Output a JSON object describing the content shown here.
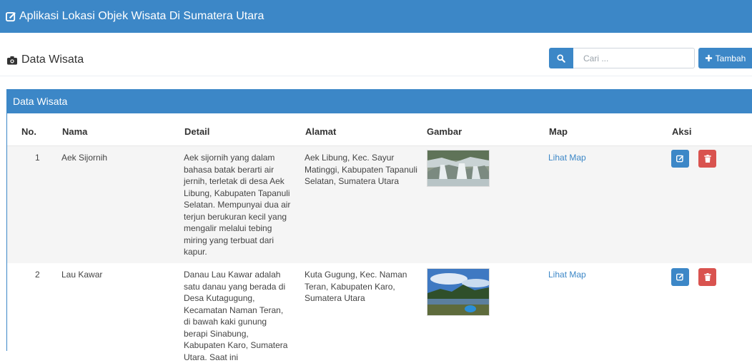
{
  "app": {
    "title": "Aplikasi Lokasi Objek Wisata Di Sumatera Utara"
  },
  "page": {
    "title": "Data Wisata"
  },
  "search": {
    "placeholder": "Cari ...",
    "value": ""
  },
  "toolbar": {
    "add_label": "Tambah"
  },
  "panel": {
    "title": "Data Wisata"
  },
  "table": {
    "headers": {
      "no": "No.",
      "nama": "Nama",
      "detail": "Detail",
      "alamat": "Alamat",
      "gambar": "Gambar",
      "map": "Map",
      "aksi": "Aksi"
    },
    "rows": [
      {
        "no": "1",
        "nama": "Aek Sijornih",
        "detail": "Aek sijornih yang dalam bahasa batak berarti air jernih, terletak di desa Aek Libung, Kabupaten Tapanuli Selatan. Mempunyai dua air terjun berukuran kecil yang mengalir melalui tebing miring yang terbuat dari kapur.",
        "alamat": "Aek Libung, Kec. Sayur Matinggi, Kabupaten Tapanuli Selatan, Sumatera Utara",
        "map": "Lihat Map",
        "image_icon": "waterfall-photo"
      },
      {
        "no": "2",
        "nama": "Lau Kawar",
        "detail": "Danau Lau Kawar adalah satu danau yang berada di Desa Kutagugung, Kecamatan Naman Teran, di bawah kaki gunung berapi Sinabung, Kabupaten Karo, Sumatera Utara. Saat ini",
        "alamat": "Kuta Gugung, Kec. Naman Teran, Kabupaten Karo, Sumatera Utara",
        "map": "Lihat Map",
        "image_icon": "lake-photo"
      }
    ]
  },
  "colors": {
    "primary": "#3c87c7",
    "danger": "#d9534f",
    "row_alt": "#f5f5f5"
  }
}
